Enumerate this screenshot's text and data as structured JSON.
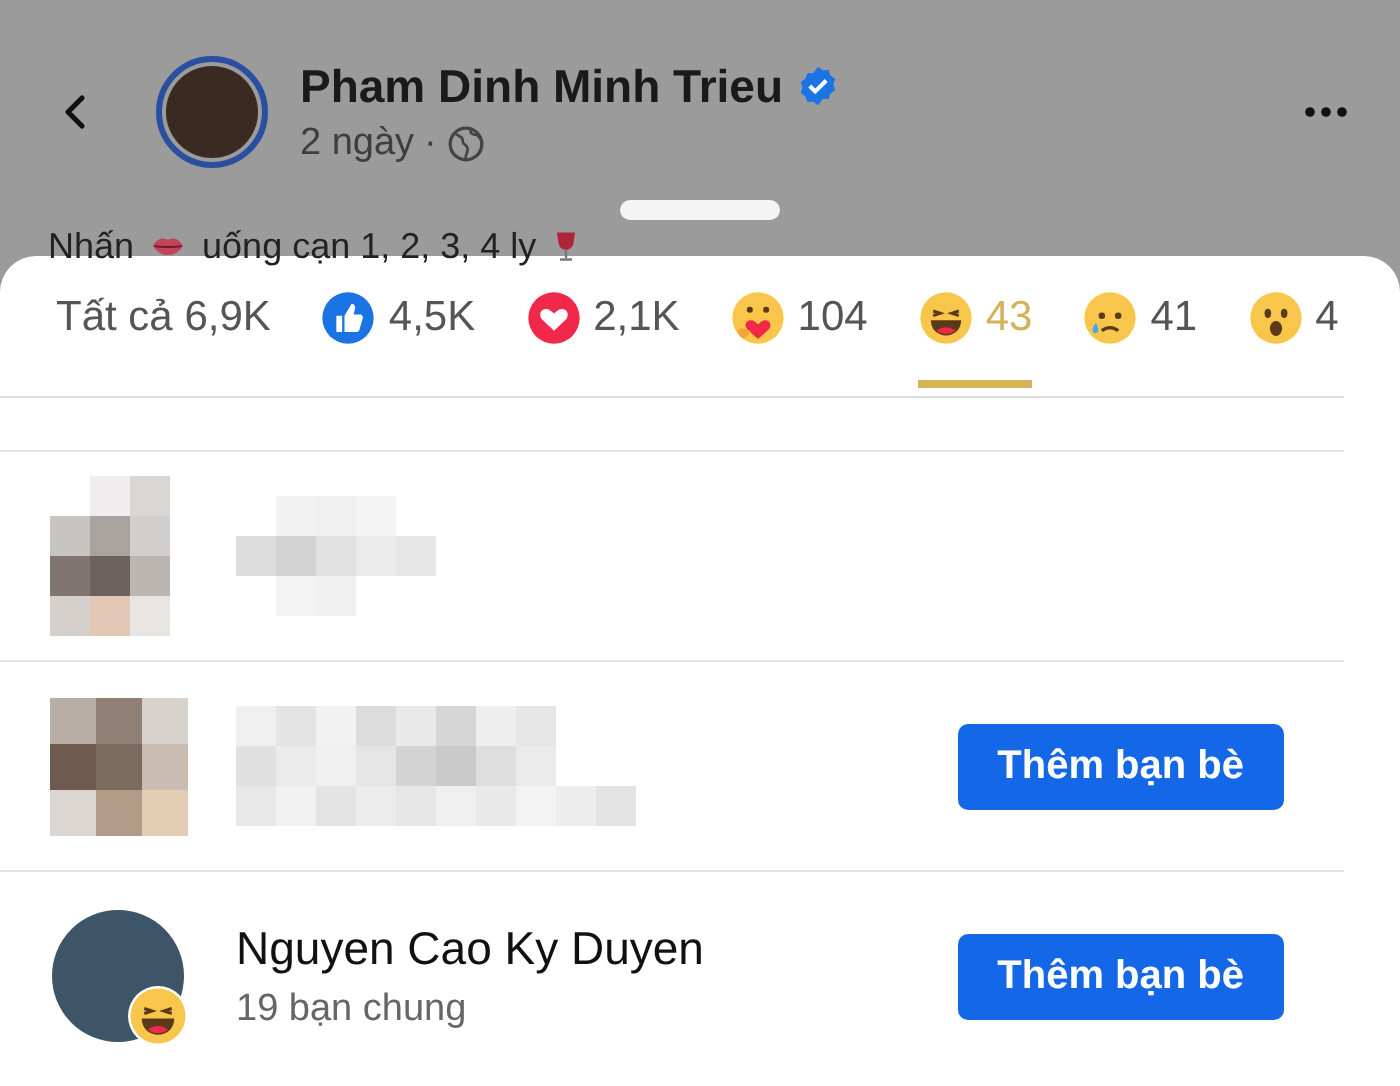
{
  "header": {
    "name": "Pham Dinh Minh Trieu",
    "verified": true,
    "time": "2 ngày",
    "separator": "·"
  },
  "post": {
    "before": "Nhấn",
    "after": "uống cạn 1, 2, 3, 4 ly"
  },
  "tabs": [
    {
      "kind": "all",
      "label": "Tất cả 6,9K",
      "selected": false
    },
    {
      "kind": "like",
      "label": "4,5K",
      "selected": false
    },
    {
      "kind": "love",
      "label": "2,1K",
      "selected": false
    },
    {
      "kind": "care",
      "label": "104",
      "selected": false
    },
    {
      "kind": "haha",
      "label": "43",
      "selected": true
    },
    {
      "kind": "sad",
      "label": "41",
      "selected": false
    },
    {
      "kind": "wow",
      "label": "4",
      "selected": false
    }
  ],
  "people": [
    {
      "kind": "hidden"
    },
    {
      "kind": "hidden",
      "button": "Thêm bạn bè"
    },
    {
      "kind": "person",
      "name": "Nguyen Cao Ky Duyen",
      "mutual": "19 bạn chung",
      "reaction": {
        "kind": "haha"
      },
      "button": "Thêm bạn bè"
    }
  ]
}
